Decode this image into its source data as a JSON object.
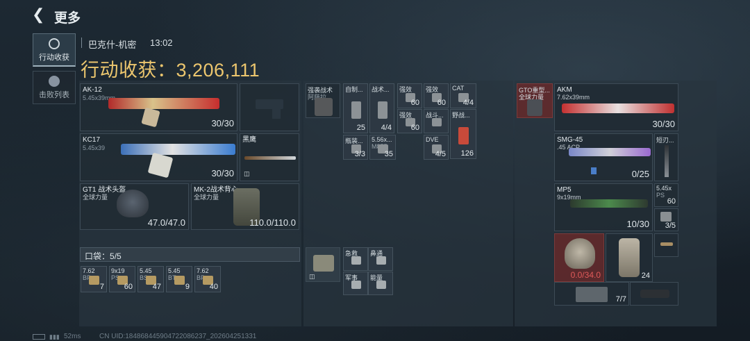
{
  "header": {
    "title": "更多"
  },
  "tabs": [
    {
      "label": "行动收获"
    },
    {
      "label": "击败列表"
    }
  ],
  "info": {
    "map": "巴克什-机密",
    "time": "13:02",
    "harvest_label": "行动收获：",
    "harvest_value": "3,206,111"
  },
  "weapons": {
    "primary": {
      "name": "AK-12",
      "caliber": "5.45x39mm",
      "ammo": "30/30"
    },
    "secondary": {
      "name": "KC17",
      "caliber": "5.45x39",
      "ammo": "30/30"
    },
    "melee": {
      "name": "黑鹰"
    }
  },
  "armor": {
    "helmet": {
      "name": "GT1 战术头盔",
      "sub": "全球力量",
      "durability": "47.0/47.0"
    },
    "vest": {
      "name": "MK-2战术背心",
      "sub": "全球力量",
      "durability": "110.0/110.0"
    }
  },
  "pouch": {
    "label": "口袋：",
    "count": "5/5",
    "items": [
      {
        "name": "7.62",
        "sub": "BP",
        "count": "7"
      },
      {
        "name": "9x19",
        "sub": "PS",
        "count": "60"
      },
      {
        "name": "5.45",
        "sub": "BS",
        "count": "47"
      },
      {
        "name": "5.45",
        "sub": "BT",
        "count": "9"
      },
      {
        "name": "7.62",
        "sub": "BP",
        "count": "40"
      }
    ]
  },
  "rig": {
    "name": "强袭战术",
    "sub": "阿萨拉",
    "items": [
      {
        "name": "自制...",
        "count": "25"
      },
      {
        "name": "战术...",
        "count": "4/4"
      },
      {
        "name": "强效",
        "count": "60"
      },
      {
        "name": "强效",
        "count": "60"
      },
      {
        "name": "CAT",
        "count": "4/4"
      },
      {
        "name": "强效",
        "count": "60"
      },
      {
        "name": "战斗...",
        "count": ""
      },
      {
        "name": "野战...",
        "count": "126"
      },
      {
        "name": "瓶装...",
        "count": "3/3"
      },
      {
        "name": "5.56x...",
        "sub": "M855",
        "count": "35"
      },
      {
        "name": "DVE",
        "count": "4/5"
      }
    ]
  },
  "case": {
    "items": [
      {
        "name": "急救",
        "count": ""
      },
      {
        "name": "鼻通",
        "count": ""
      },
      {
        "name": "军事",
        "count": ""
      },
      {
        "name": "能量",
        "count": ""
      }
    ]
  },
  "enemy": {
    "vest": {
      "name": "GTO重型...",
      "sub": "全球力量"
    },
    "primary": {
      "name": "AKM",
      "caliber": "7.62x39mm",
      "ammo": "30/30"
    },
    "smg": {
      "name": "SMG-45",
      "caliber": ".45 ACP",
      "ammo": "0/25"
    },
    "knife": {
      "name": "短刃..."
    },
    "mp5": {
      "name": "MP5",
      "caliber": "9x19mm",
      "ammo": "10/30"
    },
    "ammo1": {
      "name": "5.45x",
      "sub": "PS",
      "count": "60"
    },
    "ammo2": {
      "count": "3/5"
    },
    "helmet": {
      "durability": "0.0/34.0"
    },
    "bag": {
      "count": "24"
    },
    "box": {
      "count": "7/7"
    }
  },
  "footer": {
    "ping": "52ms",
    "uid": "CN UID:184868445904722086237_202604251331"
  },
  "colors": {
    "gold": "#ecc66e",
    "red_slot": "#6e2828",
    "accent_blue": "#4a7ec8"
  }
}
